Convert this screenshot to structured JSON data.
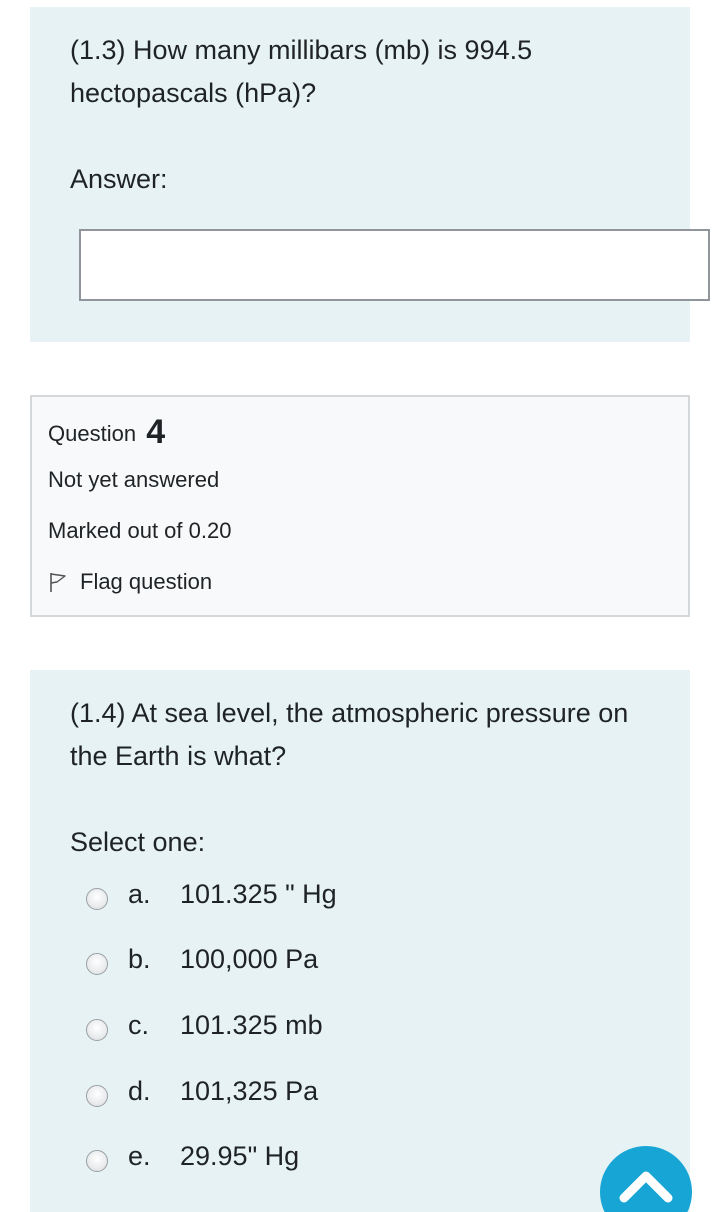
{
  "question3": {
    "text": "(1.3) How many millibars (mb) is 994.5 hectopascals (hPa)?",
    "answer_label": "Answer:",
    "answer_value": ""
  },
  "question4_info": {
    "question_word": "Question",
    "number": "4",
    "state": "Not yet answered",
    "grade": "Marked out of 0.20",
    "flag_label": "Flag question"
  },
  "question4": {
    "text": "(1.4) At sea level, the atmospheric pressure on the Earth is what?",
    "select_label": "Select one:",
    "options": [
      {
        "letter": "a.",
        "text": "101.325 \" Hg"
      },
      {
        "letter": "b.",
        "text": "100,000 Pa"
      },
      {
        "letter": "c.",
        "text": "101.325 mb"
      },
      {
        "letter": "d.",
        "text": "101,325 Pa"
      },
      {
        "letter": "e.",
        "text": "29.95\" Hg"
      }
    ]
  },
  "icons": {
    "flag": "flag-outline-icon",
    "back_to_top": "chevron-up-icon"
  },
  "colors": {
    "panel_bg": "#e6f2f4",
    "info_bg": "#f8f9fa",
    "accent": "#17a5d5"
  }
}
